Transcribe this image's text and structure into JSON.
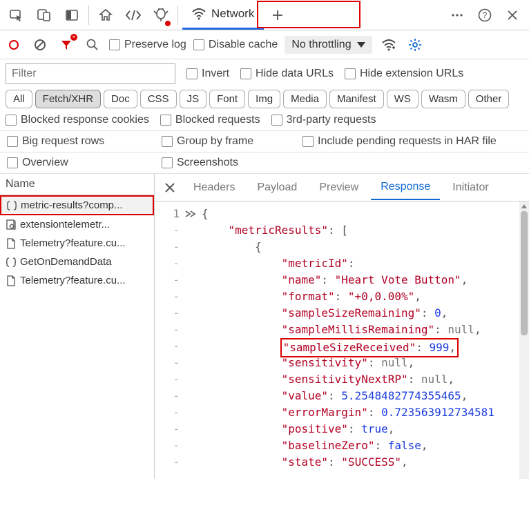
{
  "topTabs": {
    "network": {
      "label": "Network"
    }
  },
  "toolbar": {
    "preserveLog": "Preserve log",
    "disableCache": "Disable cache",
    "throttle": "No throttling"
  },
  "filter": {
    "placeholder": "Filter",
    "invert": "Invert",
    "hideDataUrls": "Hide data URLs",
    "hideExtUrls": "Hide extension URLs",
    "pills": [
      "All",
      "Fetch/XHR",
      "Doc",
      "CSS",
      "JS",
      "Font",
      "Img",
      "Media",
      "Manifest",
      "WS",
      "Wasm",
      "Other"
    ],
    "activePillIndex": 1,
    "blockedRespCookies": "Blocked response cookies",
    "blockedReq": "Blocked requests",
    "thirdParty": "3rd-party requests"
  },
  "options": {
    "bigRows": "Big request rows",
    "groupFrame": "Group by frame",
    "includePending": "Include pending requests in HAR file",
    "overview": "Overview",
    "screenshots": "Screenshots"
  },
  "namePanel": {
    "header": "Name",
    "items": [
      {
        "label": "metric-results?comp...",
        "iconType": "json"
      },
      {
        "label": "extensiontelemetr...",
        "iconType": "gear"
      },
      {
        "label": "Telemetry?feature.cu...",
        "iconType": "doc"
      },
      {
        "label": "GetOnDemandData",
        "iconType": "json"
      },
      {
        "label": "Telemetry?feature.cu...",
        "iconType": "doc"
      }
    ],
    "selectedIndex": 0
  },
  "detailTabs": {
    "headers": "Headers",
    "payload": "Payload",
    "preview": "Preview",
    "response": "Response",
    "initiator": "Initiator"
  },
  "response": {
    "lineNumber": "1",
    "json": {
      "rootKey": "metricResults",
      "metricId": "metricId",
      "name": {
        "key": "name",
        "value": "Heart Vote Button"
      },
      "format": {
        "key": "format",
        "value": "+0,0.00%"
      },
      "sampleSizeRemaining": {
        "key": "sampleSizeRemaining",
        "value": 0
      },
      "sampleMillisRemaining": {
        "key": "sampleMillisRemaining",
        "value": "null"
      },
      "sampleSizeReceived": {
        "key": "sampleSizeReceived",
        "value": 999
      },
      "sensitivity": {
        "key": "sensitivity",
        "value": "null"
      },
      "sensitivityNextRP": {
        "key": "sensitivityNextRP",
        "value": "null"
      },
      "value": {
        "key": "value",
        "value": 5.2548482774355465
      },
      "errorMargin": {
        "key": "errorMargin",
        "value": 0.723563912734581
      },
      "positive": {
        "key": "positive",
        "value": "true"
      },
      "baselineZero": {
        "key": "baselineZero",
        "value": "false"
      },
      "state": {
        "key": "state",
        "value": "SUCCESS"
      }
    }
  }
}
